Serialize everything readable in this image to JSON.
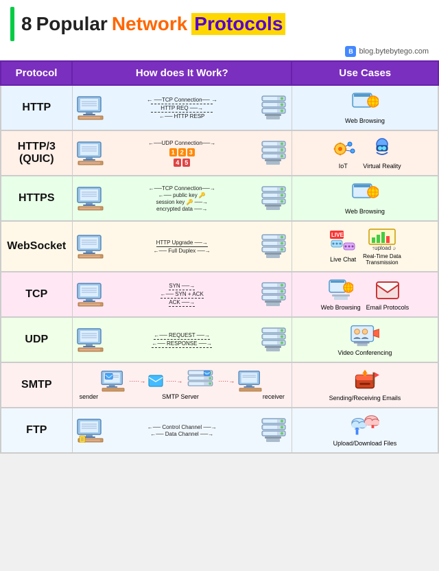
{
  "title": {
    "number": "8",
    "popular": "Popular",
    "network": "Network",
    "protocols": "Protocols"
  },
  "brand": "blog.bytebytego.com",
  "table": {
    "headers": [
      "Protocol",
      "How does It Work?",
      "Use Cases"
    ],
    "rows": [
      {
        "id": "http",
        "protocol": "HTTP",
        "steps": [
          "← TCP Connection →",
          "HTTP REQ →",
          "← HTTP RESP"
        ],
        "useCases": [
          "Web Browsing"
        ],
        "rowClass": "row-http"
      },
      {
        "id": "http3",
        "protocol": "HTTP/3\n(QUIC)",
        "steps": [
          "← UDP Connection →",
          "[1][2][3]",
          "[4][5]"
        ],
        "useCases": [
          "IoT",
          "Virtual Reality"
        ],
        "rowClass": "row-http3"
      },
      {
        "id": "https",
        "protocol": "HTTPS",
        "steps": [
          "← TCP Connection→",
          "← public key 🔑",
          "session key 🔑",
          "encrypted data"
        ],
        "useCases": [
          "Web Browsing"
        ],
        "rowClass": "row-https"
      },
      {
        "id": "websocket",
        "protocol": "WebSocket",
        "steps": [
          "HTTP Upgrade →",
          "← Full Duplex →"
        ],
        "useCases": [
          "Live Chat",
          "Real-Time Data\nTransmission"
        ],
        "rowClass": "row-websocket"
      },
      {
        "id": "tcp",
        "protocol": "TCP",
        "steps": [
          "SYN →",
          "← SYN + ACK",
          "ACK →"
        ],
        "useCases": [
          "Web Browsing",
          "Email Protocols"
        ],
        "rowClass": "row-tcp"
      },
      {
        "id": "udp",
        "protocol": "UDP",
        "steps": [
          "← REQUEST →",
          "← RESPONSE →"
        ],
        "useCases": [
          "Video Conferencing"
        ],
        "rowClass": "row-udp"
      },
      {
        "id": "smtp",
        "protocol": "SMTP",
        "steps": [
          "sender → SMTP Server → receiver"
        ],
        "useCases": [
          "Sending/Receiving Emails"
        ],
        "rowClass": "row-smtp"
      },
      {
        "id": "ftp",
        "protocol": "FTP",
        "steps": [
          "← Control Channel →",
          "← Data Channel →"
        ],
        "useCases": [
          "Upload/Download Files"
        ],
        "rowClass": "row-ftp"
      }
    ]
  }
}
